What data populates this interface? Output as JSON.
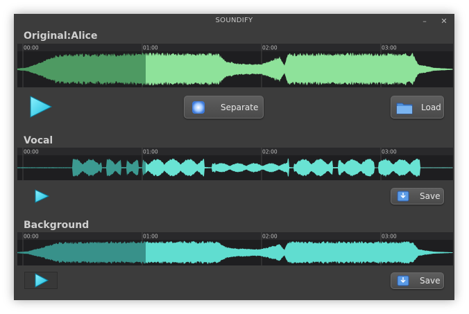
{
  "window": {
    "title": "SOUNDIFY",
    "minimize_glyph": "–",
    "close_glyph": "✕"
  },
  "timeline": {
    "tick_labels": [
      "00:00",
      "01:00",
      "02:00",
      "03:00"
    ]
  },
  "sections": {
    "original": {
      "title": "Original:Alice",
      "separate_label": "Separate",
      "load_label": "Load",
      "icons": {
        "play": "play-icon",
        "separate": "separate-icon",
        "load": "folder-icon"
      }
    },
    "vocal": {
      "title": "Vocal",
      "save_label": "Save",
      "icons": {
        "play": "play-icon",
        "save": "save-icon"
      }
    },
    "background": {
      "title": "Background",
      "save_label": "Save",
      "icons": {
        "play": "play-icon",
        "save": "save-icon"
      }
    }
  },
  "colors": {
    "window_bg": "#3c3c3c",
    "waveform_bg": "#1e1e20",
    "original_wave": "#8ee29a",
    "original_played": "#4e9a62",
    "vocal_wave": "#69e3d3",
    "vocal_played": "#3c9a91",
    "background_wave": "#60ddd0",
    "background_played": "#38918a",
    "play_icon": "#2ad4ee"
  }
}
